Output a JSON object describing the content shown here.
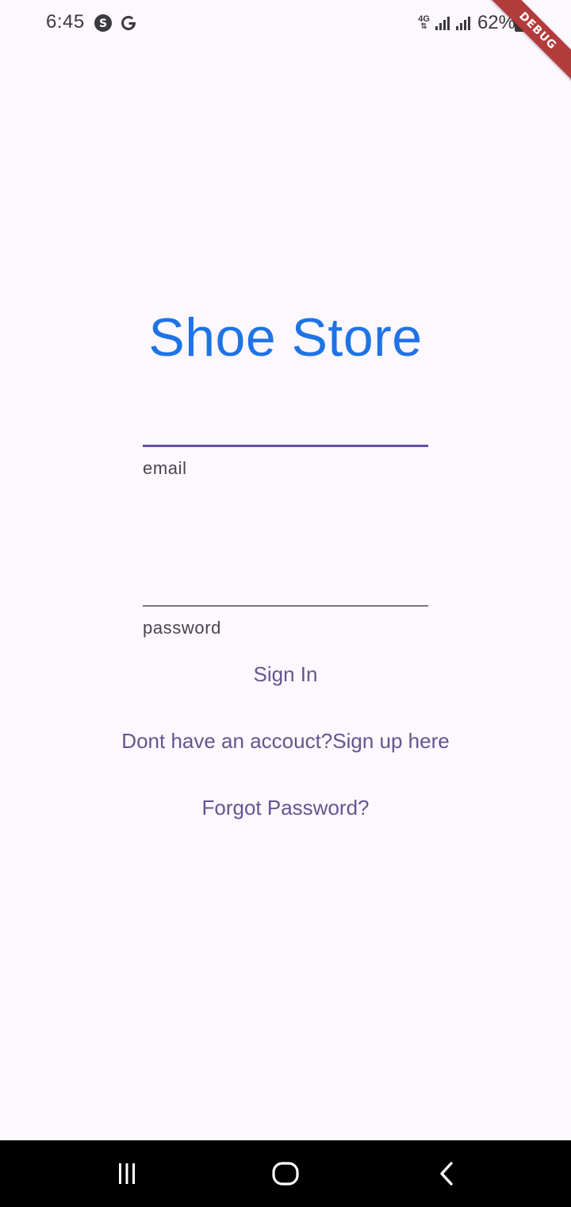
{
  "status_bar": {
    "time": "6:45",
    "notification_icons": [
      "skype-icon",
      "google-icon"
    ],
    "network_type": "4G",
    "battery_percent": "62%"
  },
  "debug_banner": "DEBUG",
  "login": {
    "title": "Shoe Store",
    "email": {
      "value": "",
      "label": "email"
    },
    "password": {
      "value": "",
      "label": "password"
    },
    "sign_in_label": "Sign In",
    "sign_up_label": "Dont have an accouct?Sign up here",
    "forgot_label": "Forgot Password?"
  },
  "colors": {
    "background": "#fdf7fe",
    "title": "#1e73e6",
    "accent": "#6750a4",
    "button_text": "#65558f"
  },
  "nav_bar": {
    "icons": [
      "recent-apps-icon",
      "home-icon",
      "back-icon"
    ]
  }
}
